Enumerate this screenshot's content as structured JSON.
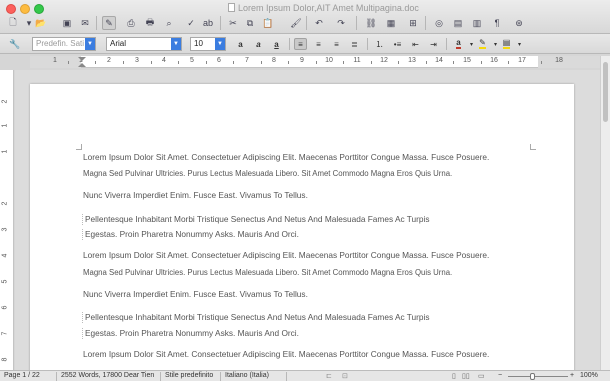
{
  "window": {
    "title": "Lorem Ipsum Dolor,AIT Amet Multipagina.doc"
  },
  "format_bar": {
    "paragraph_style": "Predefin. Sati",
    "font_name": "Arial",
    "font_size": "10"
  },
  "ruler": {
    "numbers": [
      "1",
      "1",
      "2",
      "3",
      "4",
      "5",
      "6",
      "7",
      "8",
      "9",
      "10",
      "11",
      "12",
      "13",
      "14",
      "15",
      "16",
      "17",
      "18"
    ]
  },
  "vruler": {
    "numbers": [
      "2",
      "1",
      "1",
      "2",
      "3",
      "4",
      "5",
      "6",
      "7",
      "8"
    ]
  },
  "document": {
    "paragraphs": [
      "Lorem Ipsum Dolor Sit Amet. Consectetuer Adipiscing Elit. Maecenas Porttitor Congue Massa. Fusce Posuere.",
      "Magna Sed Pulvinar Ultricies. Purus Lectus Malesuada Libero. Sit Amet Commodo Magna Eros Quis Urna.",
      "Nunc Viverra Imperdiet Enim. Fusce East. Vivamus To Tellus.",
      "Pellentesque Inhabitant Morbi Tristique Senectus And Netus And Malesuada Fames Ac Turpis",
      "Egestas. Proin Pharetra Nonummy Asks. Mauris And Orci.",
      "Lorem Ipsum Dolor Sit Amet. Consectetuer Adipiscing Elit. Maecenas Porttitor Congue Massa. Fusce Posuere.",
      "Magna Sed Pulvinar Ultricies. Purus Lectus Malesuada Libero. Sit Amet Commodo Magna Eros Quis Urna.",
      "Nunc Viverra Imperdiet Enim. Fusce East. Vivamus To Tellus.",
      "Pellentesque Inhabitant Morbi Tristique Senectus And Netus And Malesuada Fames Ac Turpis",
      "Egestas. Proin Pharetra Nonummy Asks. Mauris And Orci.",
      "Lorem Ipsum Dolor Sit Amet. Consectetuer Adipiscing Elit. Maecenas Porttitor Congue Massa. Fusce Posuere."
    ]
  },
  "statusbar": {
    "page": "Page 1 / 22",
    "words": "2552 Words, 17800 Dear Tien",
    "style": "Stile predefinito",
    "language": "Italiano (Italia)",
    "zoom": "100%"
  },
  "colors": {
    "accent": "#3b7de0",
    "font_color": "#c0392b",
    "highlight": "#f5d90a"
  }
}
